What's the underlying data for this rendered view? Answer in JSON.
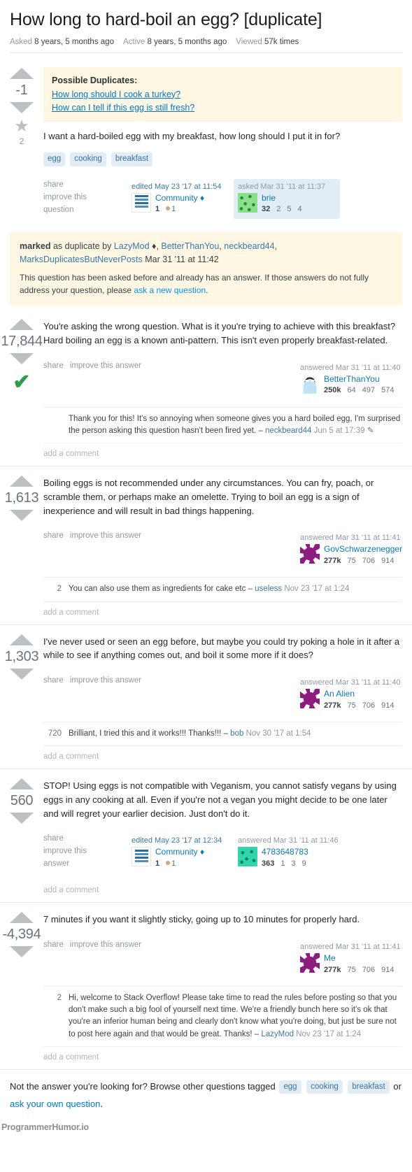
{
  "question": {
    "title": "How long to hard-boil an egg? [duplicate]",
    "stats": {
      "asked_label": "Asked",
      "asked_value": "8 years, 5 months ago",
      "active_label": "Active",
      "active_value": "8 years, 5 months ago",
      "viewed_label": "Viewed",
      "viewed_value": "57k times"
    },
    "score": "-1",
    "favorites": "2",
    "duplicates_banner": {
      "heading": "Possible Duplicates:",
      "links": [
        "How long should I cook a turkey?",
        "How can I tell if this egg is still fresh?"
      ]
    },
    "body": "I want a hard-boiled egg with my breakfast, how long should I put it in for?",
    "tags": [
      "egg",
      "cooking",
      "breakfast"
    ],
    "actions": [
      "share",
      "improve this",
      "question"
    ],
    "editor": {
      "when": "edited May 23 '17 at 11:54",
      "name": "Community",
      "is_mod": true,
      "rep": "1",
      "badge_bronze": "1",
      "avatar": "community-stack-icon"
    },
    "author": {
      "when": "asked Mar 31 '11 at 11:37",
      "name": "brie",
      "rep": "32",
      "badge_gold": "2",
      "badge_silver": "5",
      "badge_bronze": "4",
      "avatar": "green-identicon-avatar"
    }
  },
  "duplicate_notice": {
    "prefix_bold": "marked",
    "prefix_rest": " as duplicate by ",
    "moderators": [
      {
        "name": "LazyMod",
        "is_mod": true
      },
      {
        "name": "BetterThanYou",
        "is_mod": false
      },
      {
        "name": "neckbeard44",
        "is_mod": false
      },
      {
        "name": "MarksDuplicatesButNeverPosts",
        "is_mod": false
      }
    ],
    "when": "Mar 31 '11 at 11:42",
    "explanation_before": "This question has been asked before and already has an answer. If those answers do not fully address your question, please ",
    "explanation_link": "ask a new question",
    "explanation_after": "."
  },
  "answers": [
    {
      "score": "17,844",
      "accepted": true,
      "body": "You're asking the wrong question. What is it you're trying to achieve with this breakfast? Hard boiling an egg is a known anti-pattern. This isn't even properly breakfast-related.",
      "actions": [
        "share",
        "improve this answer"
      ],
      "author": {
        "when": "answered Mar 31 '11 at 11:40",
        "name": "BetterThanYou",
        "rep": "250k",
        "badge_gold": "64",
        "badge_silver": "497",
        "badge_bronze": "574",
        "avatar": "octocat-avatar"
      },
      "comments": [
        {
          "score": "",
          "text": "Thank you for this! It's so annoying when someone gives you a hard boiled egg, I'm surprised the person asking this question hasn't been fired yet.",
          "dash": "– ",
          "user": "neckbeard44",
          "when": "Jun 5 at 17:39",
          "has_pencil": true
        }
      ],
      "add_comment": "add a comment"
    },
    {
      "score": "1,613",
      "accepted": false,
      "body": "Boiling eggs is not recommended under any circumstances. You can fry, poach, or scramble them, or perhaps make an omelette. Trying to boil an egg is a sign of inexperience and will result in bad things happening.",
      "actions": [
        "share",
        "improve this answer"
      ],
      "author": {
        "when": "answered Mar 31 '11 at 11:41",
        "name": "GovSchwarzenegger",
        "rep": "277k",
        "badge_gold": "75",
        "badge_silver": "706",
        "badge_bronze": "914",
        "avatar": "purple-identicon-avatar"
      },
      "comments": [
        {
          "score": "2",
          "text": "You can also use them as ingredients for cake etc ",
          "dash": "– ",
          "user": "useless",
          "when": "Nov 23 '17 at 1:24",
          "has_pencil": false
        }
      ],
      "add_comment": "add a comment"
    },
    {
      "score": "1,303",
      "accepted": false,
      "body": "I've never used or seen an egg before, but maybe you could try poking a hole in it after a while to see if anything comes out, and boil it some more if it does?",
      "actions": [
        "share",
        "improve this answer"
      ],
      "author": {
        "when": "answered Mar 31 '11 at 11:40",
        "name": "An Alien",
        "rep": "277k",
        "badge_gold": "75",
        "badge_silver": "706",
        "badge_bronze": "914",
        "avatar": "purple-identicon-avatar"
      },
      "comments": [
        {
          "score": "720",
          "text": "Brilliant, I tried this and it works!!! Thanks!!! ",
          "dash": "– ",
          "user": "bob",
          "when": "Nov 30 '17 at 1:54",
          "has_pencil": false
        }
      ],
      "add_comment": "add a comment"
    },
    {
      "score": "560",
      "accepted": false,
      "body": "STOP! Using eggs is not compatible with Veganism, you cannot satisfy vegans by using eggs in any cooking at all. Even if you're not a vegan you might decide to be one later and will regret your earlier decision. Just don't do it.",
      "actions": [
        "share",
        "improve this",
        "answer"
      ],
      "editor": {
        "when": "edited May 23 '17 at 12:34",
        "name": "Community",
        "is_mod": true,
        "rep": "1",
        "badge_bronze": "1",
        "avatar": "community-stack-icon"
      },
      "author": {
        "when": "answered Mar 31 '11 at 11:46",
        "name": "4783648783",
        "rep": "363",
        "badge_gold": "1",
        "badge_silver": "3",
        "badge_bronze": "9",
        "avatar": "teal-identicon-avatar"
      },
      "comments": [],
      "add_comment": "add a comment"
    },
    {
      "score": "-4,394",
      "accepted": false,
      "body": "7 minutes if you want it slightly sticky, going up to 10 minutes for properly hard.",
      "actions": [
        "share",
        "improve this answer"
      ],
      "author": {
        "when": "answered Mar 31 '11 at 11:41",
        "name": "Me",
        "rep": "277k",
        "badge_gold": "75",
        "badge_silver": "706",
        "badge_bronze": "914",
        "avatar": "purple-identicon-avatar"
      },
      "comments": [
        {
          "score": "2",
          "text": "Hi, welcome to Stack Overflow! Please take time to read the rules before posting so that you don't make such a big fool of yourself next time. We're a friendly bunch here so it's ok that you're an inferior human being and clearly don't know what you're doing, but just be sure not to post here again and that would be great. Thanks! ",
          "dash": "– ",
          "user": "LazyMod",
          "when": "Nov 23 '17 at 1:24",
          "has_pencil": false
        }
      ],
      "add_comment": "add a comment"
    }
  ],
  "footer": {
    "prompt": "Not the answer you're looking for? Browse other questions tagged",
    "tags": [
      "egg",
      "cooking",
      "breakfast"
    ],
    "or_text": "or",
    "ask_link": "ask your own question",
    "period": ".",
    "watermark": "ProgrammerHumor.io"
  },
  "colors": {
    "link": "#0077cc",
    "tag_bg": "#e1ecf4",
    "tag_fg": "#39739d",
    "banner_bg": "#fdf7e3",
    "accepted_green": "#2e9b47",
    "arrow_gray": "#bbc0c4"
  }
}
